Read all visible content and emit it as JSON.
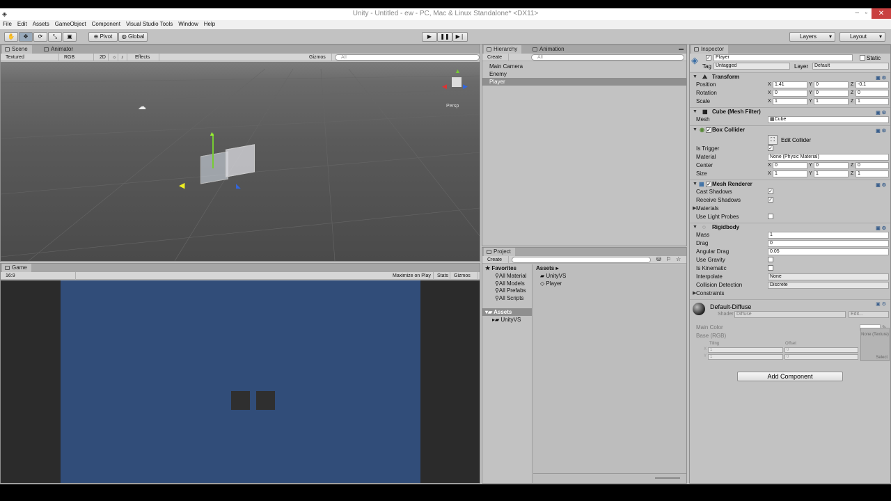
{
  "window": {
    "title": "Unity - Untitled - ew - PC, Mac & Linux Standalone* <DX11>"
  },
  "menu": [
    "File",
    "Edit",
    "Assets",
    "GameObject",
    "Component",
    "Visual Studio Tools",
    "Window",
    "Help"
  ],
  "toolbar": {
    "pivot": "Pivot",
    "global": "Global",
    "layers": "Layers",
    "layout": "Layout"
  },
  "scene": {
    "tabs": [
      "Scene",
      "Animator"
    ],
    "shading": "Textured",
    "render_mode": "RGB",
    "mode_2d": "2D",
    "effects": "Effects",
    "gizmos": "Gizmos",
    "search": "All",
    "persp": "Persp"
  },
  "game": {
    "tab": "Game",
    "aspect": "16:9",
    "maximize": "Maximize on Play",
    "stats": "Stats",
    "gizmos": "Gizmos",
    "bg_color": "#314d79"
  },
  "hierarchy": {
    "tabs": [
      "Hierarchy",
      "Animation"
    ],
    "create": "Create",
    "search": "All",
    "items": [
      "Main Camera",
      "Enemy",
      "Player"
    ],
    "selected_index": 2
  },
  "project": {
    "tab": "Project",
    "create": "Create",
    "favorites_label": "Favorites",
    "favorites": [
      "All Material",
      "All Models",
      "All Prefabs",
      "All Scripts"
    ],
    "assets_root": "Assets",
    "tree_child": "UnityVS",
    "breadcrumb": "Assets",
    "assets": [
      "UnityVS",
      "Player"
    ]
  },
  "inspector": {
    "tab": "Inspector",
    "object_name": "Player",
    "static": "Static",
    "tag_label": "Tag",
    "tag": "Untagged",
    "layer_label": "Layer",
    "layer": "Default",
    "transform": {
      "title": "Transform",
      "rows": [
        {
          "label": "Position",
          "x": "1.41",
          "y": "0",
          "z": "-0.1"
        },
        {
          "label": "Rotation",
          "x": "0",
          "y": "0",
          "z": "0"
        },
        {
          "label": "Scale",
          "x": "1",
          "y": "1",
          "z": "1"
        }
      ]
    },
    "mesh_filter": {
      "title": "Cube (Mesh Filter)",
      "mesh_label": "Mesh",
      "mesh": "Cube"
    },
    "box_collider": {
      "title": "Box Collider",
      "edit": "Edit Collider",
      "trigger_label": "Is Trigger",
      "material_label": "Material",
      "material": "None (Physic Material)",
      "center": {
        "label": "Center",
        "x": "0",
        "y": "0",
        "z": "0"
      },
      "size": {
        "label": "Size",
        "x": "1",
        "y": "1",
        "z": "1"
      }
    },
    "mesh_renderer": {
      "title": "Mesh Renderer",
      "cast": "Cast Shadows",
      "receive": "Receive Shadows",
      "materials": "Materials",
      "light_probes": "Use Light Probes"
    },
    "rigidbody": {
      "title": "Rigidbody",
      "mass_label": "Mass",
      "mass": "1",
      "drag_label": "Drag",
      "drag": "0",
      "angular_label": "Angular Drag",
      "angular": "0.05",
      "gravity_label": "Use Gravity",
      "kinematic_label": "Is Kinematic",
      "interp_label": "Interpolate",
      "interp": "None",
      "collision_label": "Collision Detection",
      "collision": "Discrete",
      "constraints": "Constraints"
    },
    "material": {
      "name": "Default-Diffuse",
      "shader_label": "Shader",
      "shader": "Diffuse",
      "edit": "Edit...",
      "main_color": "Main Color",
      "base": "Base (RGB)",
      "tiling": "Tiling",
      "offset": "Offset",
      "tile_x": "1",
      "tile_y": "1",
      "off_x": "0",
      "off_y": "0",
      "tex_none": "None (Texture)",
      "select": "Select"
    },
    "add_component": "Add Component"
  },
  "axes": {
    "x": "X",
    "y": "Y",
    "z": "Z"
  }
}
